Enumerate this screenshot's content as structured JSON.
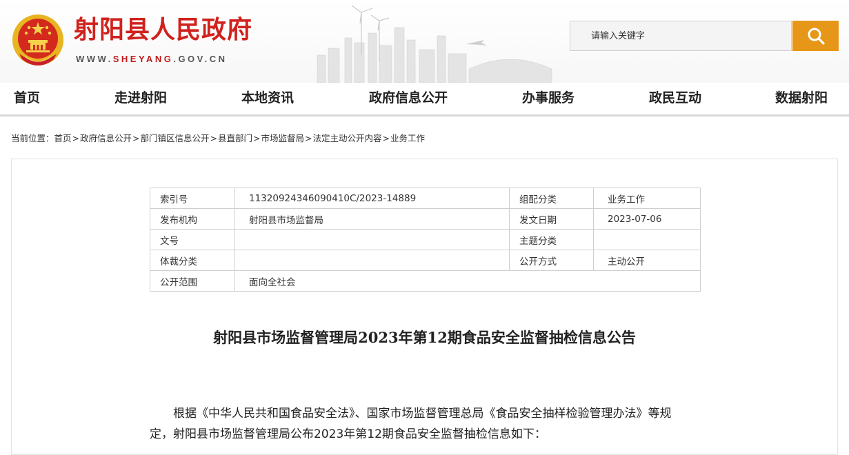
{
  "header": {
    "site_title": "射阳县人民政府",
    "domain_prefix": "WWW.",
    "domain_accent": "SHEYANG",
    "domain_suffix": ".GOV.CN",
    "search_placeholder": "请输入关键字",
    "search_value": ""
  },
  "nav": {
    "items": [
      {
        "label": "首页"
      },
      {
        "label": "走进射阳"
      },
      {
        "label": "本地资讯"
      },
      {
        "label": "政府信息公开"
      },
      {
        "label": "办事服务"
      },
      {
        "label": "政民互动"
      },
      {
        "label": "数据射阳"
      }
    ]
  },
  "breadcrumb": {
    "prefix": "当前位置：",
    "separator": ">",
    "items": [
      "首页",
      "政府信息公开",
      "部门镇区信息公开",
      "县直部门",
      "市场监督局",
      "法定主动公开内容",
      "业务工作"
    ]
  },
  "meta": {
    "rows": [
      {
        "k1": "索引号",
        "v1": "11320924346090410C/2023-14889",
        "k2": "组配分类",
        "v2": "业务工作"
      },
      {
        "k1": "发布机构",
        "v1": "射阳县市场监督局",
        "k2": "发文日期",
        "v2": "2023-07-06"
      },
      {
        "k1": "文号",
        "v1": "",
        "k2": "主题分类",
        "v2": ""
      },
      {
        "k1": "体裁分类",
        "v1": "",
        "k2": "公开方式",
        "v2": "主动公开"
      },
      {
        "k1": "公开范围",
        "v1": "面向全社会"
      }
    ]
  },
  "article": {
    "title": "射阳县市场监督管理局2023年第12期食品安全监督抽检信息公告",
    "body": "根据《中华人民共和国食品安全法》、国家市场监督管理总局《食品安全抽样检验管理办法》等规定，射阳县市场监督管理局公布2023年第12期食品安全监督抽检信息如下："
  },
  "colors": {
    "brand_red": "#d0211c",
    "search_orange": "#e69717",
    "nav_border": "#d8d8d8"
  },
  "icons": {
    "emblem": "national-emblem-icon",
    "search": "search-icon"
  }
}
